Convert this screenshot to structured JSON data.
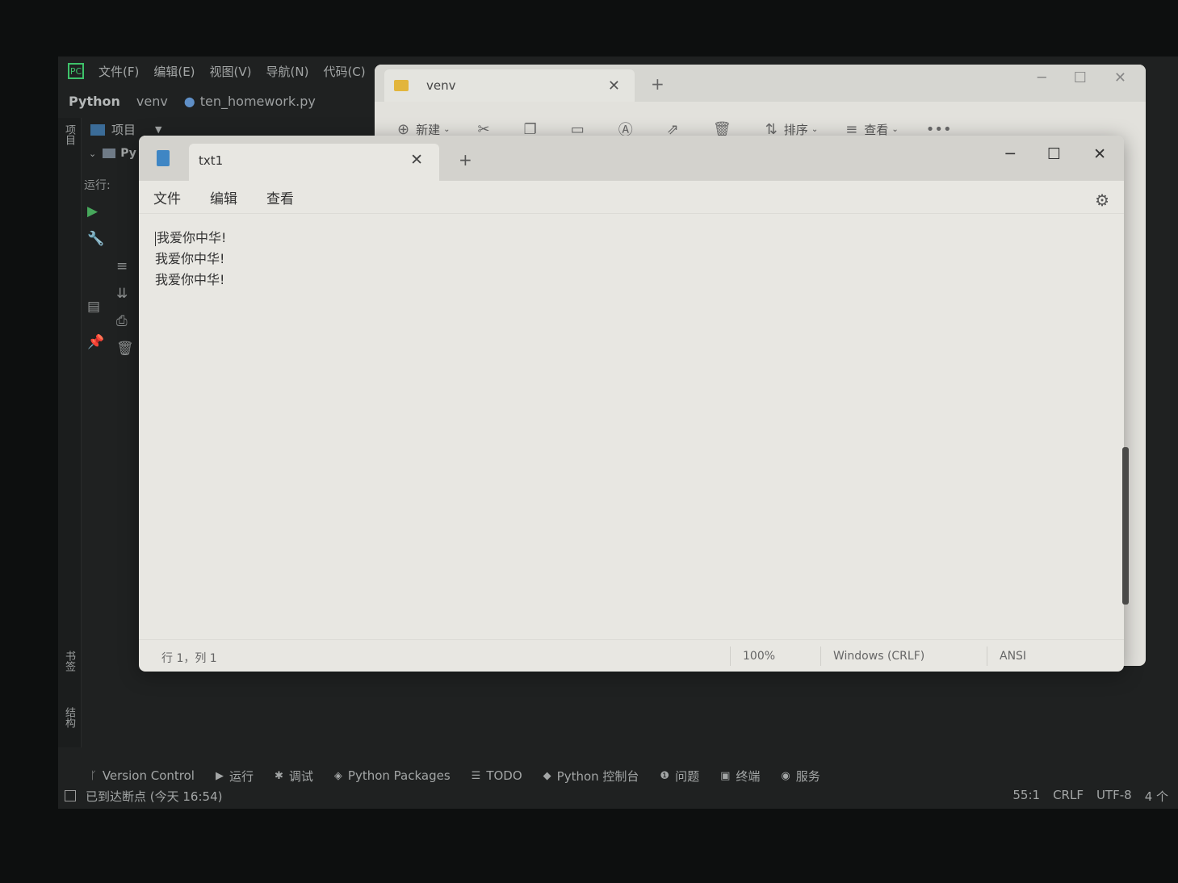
{
  "ide": {
    "menu": [
      "文件(F)",
      "编辑(E)",
      "视图(V)",
      "导航(N)",
      "代码(C)"
    ],
    "breadcrumb": {
      "project": "Python",
      "folder": "venv",
      "file": "ten_homework.py"
    },
    "left_tab_project": "项目",
    "project_label": "项目",
    "tree_root": "Py",
    "run_label": "运行:",
    "left_tab_bookmarks": "书签",
    "left_tab_structure": "结构",
    "bottom_tabs": [
      "Version Control",
      "运行",
      "调试",
      "Python Packages",
      "TODO",
      "Python 控制台",
      "问题",
      "终端",
      "服务"
    ],
    "status_message": "已到达断点 (今天 16:54)",
    "status_right": [
      "55:1",
      "CRLF",
      "UTF-8",
      "4 个"
    ]
  },
  "explorer": {
    "tab_title": "venv",
    "toolbar": {
      "new_label": "新建",
      "sort_label": "排序",
      "view_label": "查看"
    }
  },
  "notepad": {
    "tab_title": "txt1",
    "menu": [
      "文件",
      "编辑",
      "查看"
    ],
    "lines": [
      "我爱你中华!",
      "我爱你中华!",
      "我爱你中华!"
    ],
    "status": {
      "position": "行 1，列 1",
      "zoom": "100%",
      "line_ending": "Windows (CRLF)",
      "encoding": "ANSI"
    }
  }
}
